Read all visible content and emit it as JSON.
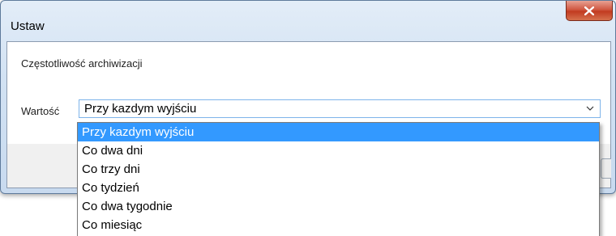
{
  "window": {
    "title": "Ustaw"
  },
  "icons": {
    "close": "close-icon",
    "dropdown": "chevron-down-icon"
  },
  "colors": {
    "selection": "#3399ff",
    "close_button": "#c13b21"
  },
  "dialog": {
    "heading": "Częstotliwość archiwizacji",
    "field_label": "Wartość",
    "selected_value": "Przy kazdym wyjściu",
    "options": [
      {
        "label": "Przy kazdym wyjściu",
        "selected": true
      },
      {
        "label": "Co dwa dni"
      },
      {
        "label": "Co trzy dni"
      },
      {
        "label": "Co tydzień"
      },
      {
        "label": "Co dwa tygodnie"
      },
      {
        "label": "Co miesiąc"
      }
    ]
  }
}
